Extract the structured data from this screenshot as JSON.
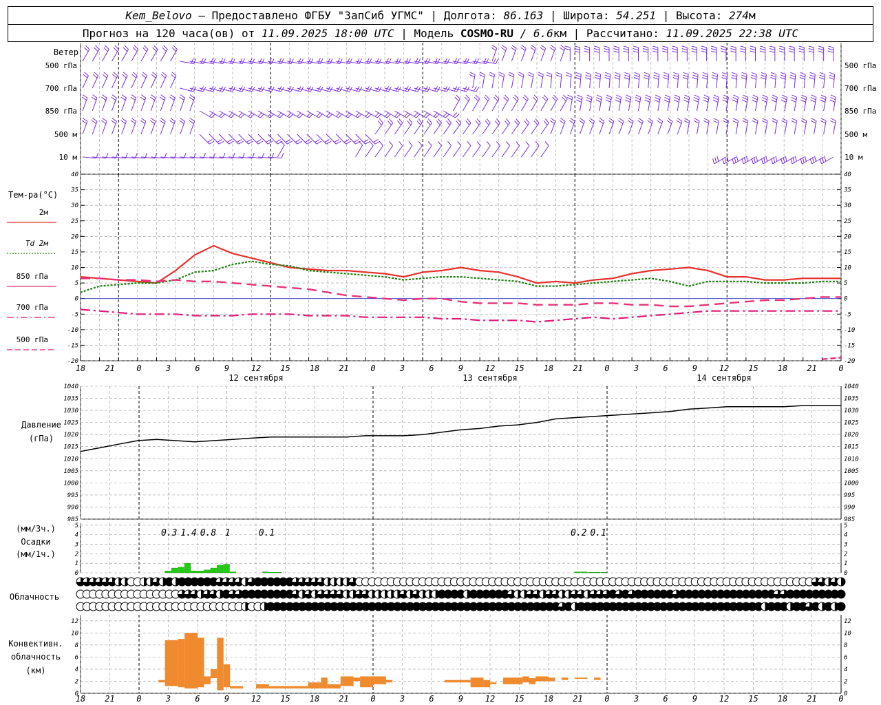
{
  "header": {
    "line1": {
      "station": "Kem_Belovo",
      "provider": " – Предоставлено ФГБУ \"ЗапСиб УГМС\" | Долгота: ",
      "lon": "86.163",
      "lat_label": " | Широта: ",
      "lat": "54.251",
      "alt_label": " | Высота: ",
      "alt": "274",
      "alt_unit": "м"
    },
    "line2": {
      "prefix": "Прогноз на 120 часа(ов) от ",
      "issued": "11.09.2025 18:00 UTC",
      "model_label": "  | Модель ",
      "model": "COSMO-RU",
      "res": " / 6.6",
      "res_unit": "км",
      "calc_label": " | Рассчитано: ",
      "calc": "11.09.2025 22:38 UTC"
    }
  },
  "wind_panel": {
    "title": "Ветер",
    "levels": [
      "500 гПа",
      "700 гПа",
      "850 гПа",
      "500 м",
      "10  м"
    ],
    "levels_right": [
      "500 гПа",
      "700 гПа",
      "850 гПа",
      "500 м",
      "10  м"
    ]
  },
  "temp_panel": {
    "title": "Тем-ра(°C)",
    "legend": [
      {
        "label": "2м",
        "color": "#e8302c",
        "dash": "solid"
      },
      {
        "label": "Td  2м",
        "color": "#2e7d12",
        "dash": "dotted"
      },
      {
        "label": "850 гПа",
        "color": "#e8307a",
        "dash": "solid"
      },
      {
        "label": "700 гПа",
        "color": "#e0197a",
        "dash": "dashdot"
      },
      {
        "label": "500 гПа",
        "color": "#e0197a",
        "dash": "dashed"
      }
    ],
    "yticks": [
      "40",
      "35",
      "30",
      "25",
      "20",
      "15",
      "10",
      "5",
      "0",
      "-5",
      "-10",
      "-15",
      "-20"
    ]
  },
  "time_axis": {
    "hours": [
      "18",
      "21",
      "0",
      "3",
      "6",
      "9",
      "12",
      "15",
      "18",
      "21",
      "0",
      "3",
      "6",
      "9",
      "12",
      "15",
      "18",
      "21",
      "0",
      "3",
      "6",
      "9",
      "12",
      "15",
      "18",
      "21",
      "0"
    ],
    "days": [
      {
        "text": "12 сентября",
        "hour": 18
      },
      {
        "text": "13 сентября",
        "hour": 42
      },
      {
        "text": "14 сентября",
        "hour": 66
      }
    ]
  },
  "pressure_panel": {
    "title": "Давление",
    "unit": "(гПа)",
    "yticks": [
      "1040",
      "1035",
      "1030",
      "1025",
      "1020",
      "1015",
      "1010",
      "1005",
      "1000",
      "995",
      "990",
      "985"
    ]
  },
  "precip_panel": {
    "title": "Осадки",
    "unit_top": "(мм/3ч.)",
    "unit_bottom": "(мм/1ч.)",
    "yticks": [
      "5",
      "4",
      "3",
      "2",
      "1",
      "0"
    ],
    "totals": [
      {
        "text": "0.3",
        "hour": 13
      },
      {
        "text": "1.4",
        "hour": 16
      },
      {
        "text": "0.8",
        "hour": 19
      },
      {
        "text": "1",
        "hour": 22
      },
      {
        "text": "0.1",
        "hour": 28
      },
      {
        "text": "0.2",
        "hour": 76
      },
      {
        "text": "0.1",
        "hour": 79
      }
    ]
  },
  "cloud_panel": {
    "title": "Облачность"
  },
  "conv_panel": {
    "title_l1": "Конвективн.",
    "title_l2": "облачность",
    "unit": "(км)",
    "yticks": [
      "12",
      "10",
      "8",
      "6",
      "4",
      "2",
      "0"
    ]
  },
  "chart_data": [
    {
      "type": "line",
      "name": "temperature",
      "xlabel": "hours",
      "ylabel": "°C",
      "ylim": [
        -20,
        40
      ],
      "x": [
        0,
        3,
        6,
        9,
        12,
        15,
        18,
        21,
        24,
        27,
        30,
        33,
        36,
        39,
        42,
        45,
        48,
        51,
        54,
        57,
        60,
        63,
        66,
        69,
        72,
        75,
        78,
        81,
        84,
        87,
        90,
        93,
        96,
        99,
        102,
        105,
        108,
        111,
        114,
        117,
        120
      ],
      "series": [
        {
          "name": "2м",
          "values": [
            7,
            6.5,
            6,
            5.5,
            5,
            9,
            14,
            17,
            14.5,
            13,
            11.5,
            10,
            9.5,
            9,
            9,
            8.5,
            8,
            7,
            8.5,
            9,
            10,
            9,
            8.5,
            7,
            5,
            5.5,
            5,
            6,
            6.5,
            8,
            9,
            9.5,
            10,
            9,
            7,
            7,
            6,
            6,
            6.5,
            6.5,
            6.5
          ]
        },
        {
          "name": "Td 2м",
          "values": [
            2,
            4,
            4.5,
            5,
            5,
            6,
            8.5,
            9,
            11,
            12,
            11,
            10.5,
            9,
            8.5,
            8,
            7.5,
            7,
            6,
            6.5,
            7,
            7,
            6.5,
            6,
            5.5,
            4,
            4,
            4.5,
            5,
            5.5,
            6,
            6.5,
            5.5,
            4,
            5.5,
            5.5,
            5.5,
            5,
            5,
            5,
            5.5,
            5.5
          ]
        },
        {
          "name": "850 гПа",
          "values": [
            6.5,
            6.5,
            6,
            6,
            5.5,
            6,
            5.5,
            5.5,
            5,
            4.5,
            4,
            3.5,
            3,
            2,
            1,
            0.5,
            0,
            -0.5,
            0,
            0,
            -1,
            -1.5,
            -1.5,
            -1.5,
            -2,
            -2,
            -2,
            -1.5,
            -1.5,
            -2,
            -2,
            -2.5,
            -2.5,
            -2,
            -1.5,
            -1,
            -0.5,
            -0.5,
            0,
            0.5,
            0.5
          ]
        },
        {
          "name": "700 гПа",
          "values": [
            -3.5,
            -4,
            -4.5,
            -5,
            -5,
            -5,
            -5.5,
            -5.5,
            -5.5,
            -5,
            -5,
            -5,
            -5.5,
            -5.5,
            -5.5,
            -6,
            -6,
            -6,
            -6,
            -6.5,
            -6.5,
            -7,
            -7,
            -7,
            -7.5,
            -7,
            -6.5,
            -6,
            -6.5,
            -6,
            -5.5,
            -5,
            -4.5,
            -4,
            -4,
            -4,
            -4,
            -4,
            -4,
            -4,
            -4
          ]
        },
        {
          "name": "500 гПа",
          "values": [
            null,
            null,
            null,
            null,
            null,
            null,
            null,
            null,
            null,
            null,
            null,
            null,
            null,
            null,
            null,
            null,
            null,
            null,
            null,
            null,
            null,
            null,
            null,
            null,
            null,
            null,
            null,
            null,
            null,
            null,
            null,
            null,
            null,
            null,
            null,
            null,
            null,
            null,
            null,
            -19.5,
            -19
          ]
        }
      ]
    },
    {
      "type": "line",
      "name": "pressure",
      "ylabel": "гПа",
      "ylim": [
        985,
        1040
      ],
      "x": [
        0,
        3,
        6,
        9,
        12,
        15,
        18,
        21,
        24,
        27,
        30,
        33,
        36,
        39,
        42,
        45,
        48,
        51,
        54,
        57,
        60,
        63,
        66,
        69,
        72,
        75,
        78,
        81,
        84,
        87,
        90,
        93,
        96,
        99,
        102,
        105,
        108,
        111,
        114,
        117,
        120
      ],
      "series": [
        {
          "name": "давление",
          "values": [
            1013,
            1014.5,
            1016,
            1017.5,
            1018,
            1017.5,
            1017,
            1017.5,
            1018,
            1018.5,
            1019,
            1019,
            1019,
            1019,
            1019,
            1019.5,
            1019.5,
            1019.5,
            1020,
            1021,
            1022,
            1022.5,
            1023.5,
            1024,
            1025,
            1026.5,
            1027,
            1027.5,
            1028,
            1028.5,
            1029,
            1029.5,
            1030.5,
            1031,
            1031.5,
            1031.5,
            1031.5,
            1031.5,
            1032,
            1032,
            1032
          ]
        }
      ]
    },
    {
      "type": "bar",
      "name": "precipitation",
      "ylabel": "мм/1ч.",
      "ylim": [
        0,
        5
      ],
      "x": [
        13,
        14,
        15,
        16,
        17,
        18,
        19,
        20,
        21,
        22,
        23,
        28,
        29,
        30,
        76,
        77,
        78,
        79,
        80
      ],
      "values": [
        0.2,
        0.5,
        0.6,
        1.0,
        0.2,
        0.2,
        0.3,
        0.5,
        0.8,
        0.9,
        0.1,
        0.1,
        0.05,
        0.05,
        0.1,
        0.1,
        0.05,
        0.05,
        0.05
      ]
    },
    {
      "type": "bar",
      "name": "convective_cloud",
      "ylabel": "км",
      "ylim": [
        0,
        12
      ],
      "segments": [
        {
          "x0": 12,
          "x1": 13,
          "bottom": 1.8,
          "top": 2.2
        },
        {
          "x0": 13,
          "x1": 15,
          "bottom": 1.2,
          "top": 8.8
        },
        {
          "x0": 15,
          "x1": 16,
          "bottom": 1.0,
          "top": 9
        },
        {
          "x0": 16,
          "x1": 18,
          "bottom": 0.8,
          "top": 10
        },
        {
          "x0": 18,
          "x1": 19,
          "bottom": 1.0,
          "top": 9.2
        },
        {
          "x0": 19,
          "x1": 20,
          "bottom": 1.5,
          "top": 2.8
        },
        {
          "x0": 20,
          "x1": 21,
          "bottom": 2.5,
          "top": 4
        },
        {
          "x0": 21,
          "x1": 22,
          "bottom": 0.5,
          "top": 9.2
        },
        {
          "x0": 22,
          "x1": 23,
          "bottom": 1.0,
          "top": 4.8
        },
        {
          "x0": 23,
          "x1": 25,
          "bottom": 0.8,
          "top": 1.2
        },
        {
          "x0": 27,
          "x1": 29,
          "bottom": 0.8,
          "top": 1.5
        },
        {
          "x0": 29,
          "x1": 35,
          "bottom": 0.8,
          "top": 1.2
        },
        {
          "x0": 35,
          "x1": 37,
          "bottom": 0.8,
          "top": 1.8
        },
        {
          "x0": 37,
          "x1": 38,
          "bottom": 0.8,
          "top": 2.6
        },
        {
          "x0": 38,
          "x1": 40,
          "bottom": 0.8,
          "top": 1.5
        },
        {
          "x0": 40,
          "x1": 42,
          "bottom": 1.2,
          "top": 2.8
        },
        {
          "x0": 42,
          "x1": 43,
          "bottom": 2,
          "top": 2.6
        },
        {
          "x0": 43,
          "x1": 45,
          "bottom": 1.0,
          "top": 2.8
        },
        {
          "x0": 45,
          "x1": 47,
          "bottom": 1.5,
          "top": 2.8
        },
        {
          "x0": 47,
          "x1": 48,
          "bottom": 1.8,
          "top": 2.2
        },
        {
          "x0": 56,
          "x1": 60,
          "bottom": 1.8,
          "top": 2.2
        },
        {
          "x0": 60,
          "x1": 62,
          "bottom": 1.0,
          "top": 2.6
        },
        {
          "x0": 62,
          "x1": 63,
          "bottom": 1.0,
          "top": 2.2
        },
        {
          "x0": 63,
          "x1": 64,
          "bottom": 1.5,
          "top": 1.8
        },
        {
          "x0": 65,
          "x1": 68,
          "bottom": 1.5,
          "top": 2.6
        },
        {
          "x0": 68,
          "x1": 69,
          "bottom": 1.8,
          "top": 2.8
        },
        {
          "x0": 69,
          "x1": 70,
          "bottom": 1.5,
          "top": 2.5
        },
        {
          "x0": 70,
          "x1": 72,
          "bottom": 2,
          "top": 2.8
        },
        {
          "x0": 72,
          "x1": 73,
          "bottom": 2,
          "top": 2.6
        },
        {
          "x0": 74,
          "x1": 75,
          "bottom": 2.2,
          "top": 2.6
        },
        {
          "x0": 76,
          "x1": 78,
          "bottom": 2.4,
          "top": 2.6
        },
        {
          "x0": 79,
          "x1": 80,
          "bottom": 2.2,
          "top": 2.6
        }
      ]
    },
    {
      "type": "table",
      "name": "cloudiness",
      "rows": [
        [
          0.75,
          0.75,
          0.75,
          0.75,
          0.75,
          0.75,
          0.5,
          0.5,
          0,
          0,
          0.5,
          0.5,
          0.75,
          0.5,
          1,
          0.5,
          1,
          1,
          1,
          1,
          1,
          1,
          0.75,
          0.75,
          0.75,
          0.75,
          0.5,
          0.75,
          1,
          1,
          1,
          1,
          1,
          1,
          0.75,
          0.75,
          0.75,
          0.75,
          0.75,
          0.5,
          0.5,
          0.5,
          0.5,
          0.75,
          0,
          0,
          0,
          0,
          0,
          0,
          0,
          0,
          0,
          0,
          0,
          0,
          0,
          0,
          0,
          0,
          0,
          0,
          0,
          0,
          0,
          0,
          0,
          0,
          0,
          0,
          0,
          0,
          0,
          0,
          0,
          0,
          0,
          0,
          0,
          0,
          0,
          0,
          0,
          0,
          0,
          0,
          0,
          0,
          0,
          0,
          0,
          0,
          0,
          0,
          0,
          0,
          0,
          0,
          0,
          0,
          0,
          0,
          0,
          0,
          0,
          0,
          0,
          0,
          0,
          0,
          0,
          0,
          0,
          0,
          0,
          0,
          0.75,
          0.75,
          0.5,
          0.75,
          0.5
        ],
        [
          0,
          0,
          0,
          0,
          0,
          0,
          0,
          0,
          0,
          0,
          0,
          0,
          0,
          0,
          0,
          0,
          0.75,
          0.75,
          0.75,
          0.5,
          0.75,
          0.75,
          0.5,
          1,
          0.75,
          0.75,
          1,
          1,
          1,
          1,
          1,
          1,
          1,
          1,
          0.75,
          0.5,
          0.75,
          0.5,
          0.75,
          0.75,
          0.75,
          0.75,
          0.5,
          0.5,
          0.75,
          0.75,
          0.5,
          0.5,
          0.5,
          0.5,
          0.5,
          0.75,
          0.5,
          0.75,
          0.5,
          0.5,
          0.5,
          1,
          1,
          1,
          1,
          0.5,
          1,
          1,
          1,
          1,
          1,
          1,
          0.75,
          0.5,
          0.5,
          0.75,
          0.75,
          0.5,
          0.75,
          0.75,
          0.5,
          0.5,
          0.75,
          0.75,
          0.5,
          0.75,
          0.75,
          0.75,
          1,
          0.75,
          1,
          0.75,
          1,
          1,
          1,
          1,
          1,
          1,
          0.75,
          1,
          1,
          1,
          1,
          1,
          1,
          1,
          1,
          1,
          1,
          1,
          1,
          1,
          1,
          1,
          0.75,
          0.75,
          1,
          1,
          1,
          1,
          1,
          1,
          1,
          1,
          1
        ],
        [
          0,
          0,
          0,
          0,
          0,
          0,
          0,
          0,
          0,
          0,
          0,
          0,
          0,
          0,
          0,
          0,
          0,
          0,
          0,
          0,
          0,
          0,
          0,
          0,
          0,
          0,
          0.5,
          0,
          0,
          0.5,
          1,
          1,
          1,
          1,
          1,
          1,
          1,
          1,
          1,
          1,
          1,
          1,
          1,
          1,
          1,
          1,
          1,
          1,
          1,
          1,
          1,
          1,
          1,
          1,
          1,
          1,
          1,
          1,
          1,
          1,
          1,
          1,
          1,
          1,
          1,
          1,
          1,
          1,
          1,
          1,
          1,
          1,
          1,
          1,
          1,
          1,
          0.75,
          1,
          0.5,
          1,
          1,
          1,
          1,
          1,
          1,
          1,
          1,
          1,
          1,
          1,
          1,
          1,
          1,
          1,
          1,
          1,
          1,
          1,
          1,
          1,
          1,
          1,
          1,
          1,
          1,
          1,
          1,
          1,
          0.5,
          1,
          1,
          1,
          0.5,
          1,
          1,
          0.75,
          1,
          0.5,
          1,
          0.5,
          1
        ]
      ]
    }
  ]
}
